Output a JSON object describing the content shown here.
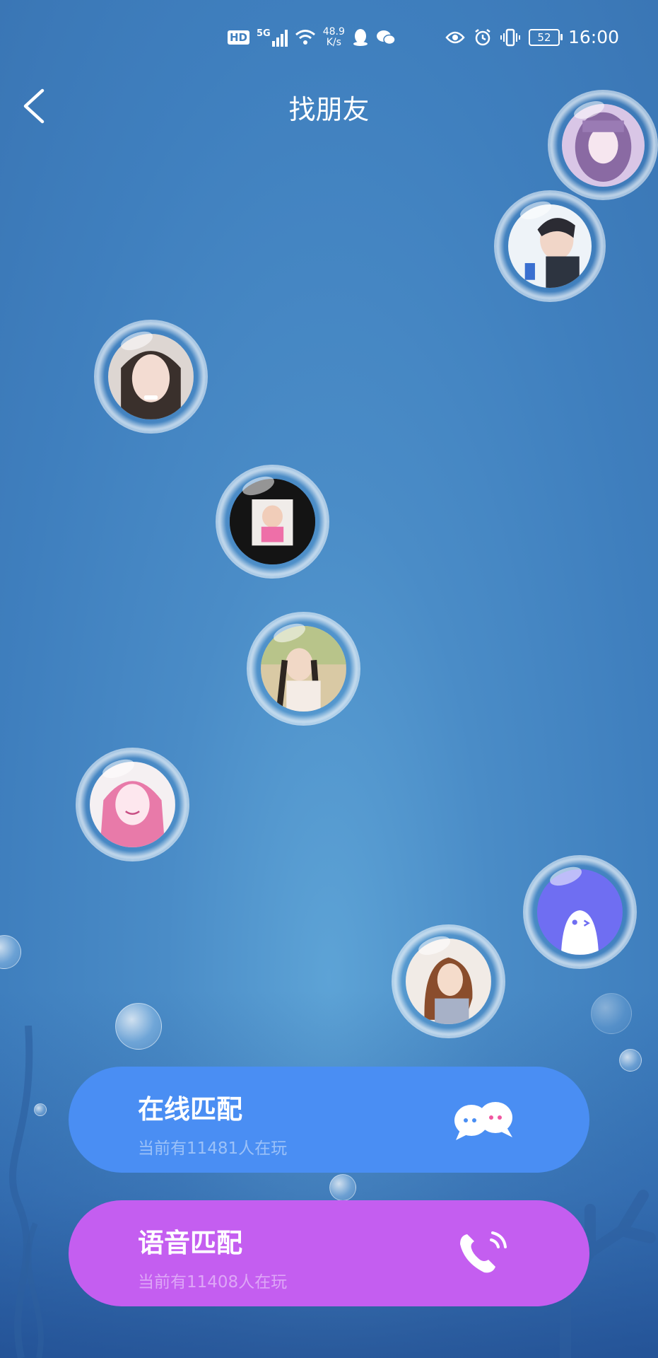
{
  "status_bar": {
    "hd": "HD",
    "network": "5G",
    "speed_value": "48.9",
    "speed_unit": "K/s",
    "battery": "52",
    "time": "16:00"
  },
  "header": {
    "title": "找朋友"
  },
  "matches": {
    "online": {
      "title": "在线匹配",
      "subtitle": "当前有11481人在玩"
    },
    "voice": {
      "title": "语音匹配",
      "subtitle": "当前有11408人在玩"
    }
  },
  "colors": {
    "online_button": "#4a8ef3",
    "voice_button": "#c45ef0",
    "background": "#4a8cc7"
  },
  "icons": {
    "back": "chevron-left-icon",
    "online_match": "chat-bubbles-icon",
    "voice_match": "phone-icon"
  }
}
